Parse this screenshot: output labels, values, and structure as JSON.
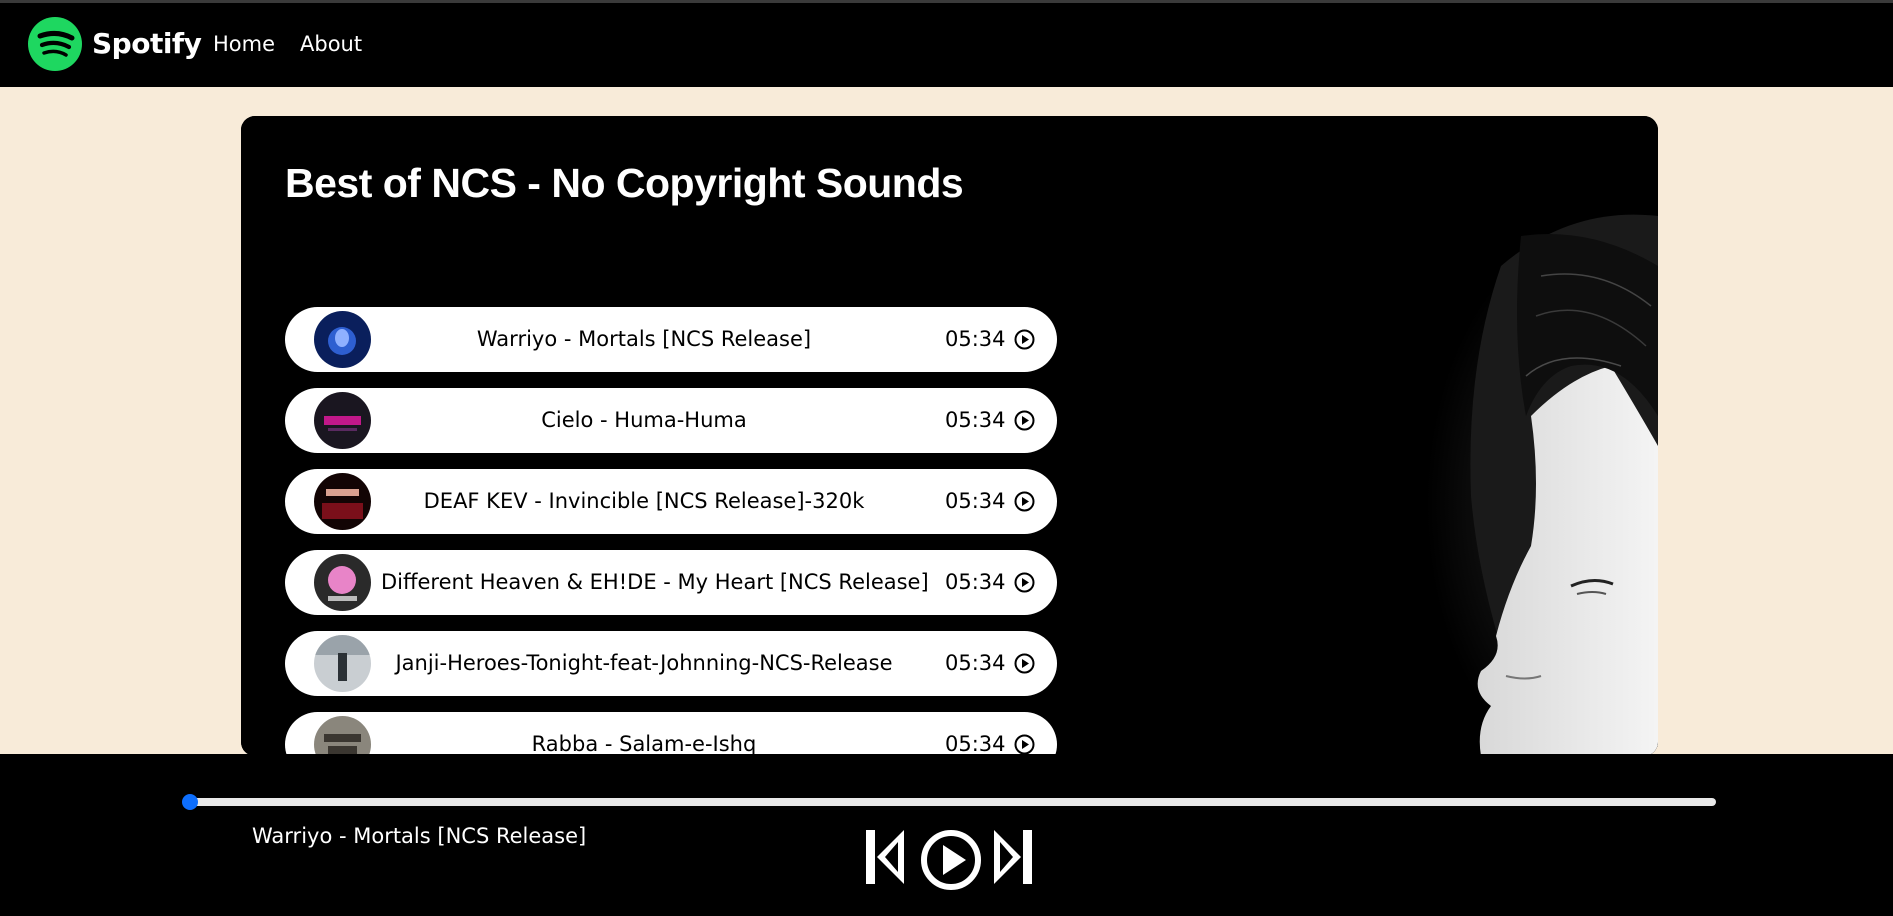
{
  "navbar": {
    "brand": "Spotify",
    "links": [
      "Home",
      "About"
    ]
  },
  "main": {
    "title": "Best of NCS - No Copyright Sounds",
    "songs": [
      {
        "name": "Warriyo - Mortals [NCS Release]",
        "duration": "05:34"
      },
      {
        "name": "Cielo - Huma-Huma",
        "duration": "05:34"
      },
      {
        "name": "DEAF KEV - Invincible [NCS Release]-320k",
        "duration": "05:34"
      },
      {
        "name": "Different Heaven & EH!DE - My Heart [NCS Release]",
        "duration": "05:34"
      },
      {
        "name": "Janji-Heroes-Tonight-feat-Johnning-NCS-Release",
        "duration": "05:34"
      },
      {
        "name": "Rabba - Salam-e-Ishq",
        "duration": "05:34"
      }
    ]
  },
  "player": {
    "now_playing": "Warriyo - Mortals [NCS Release]",
    "progress": 0
  },
  "colors": {
    "page_background": "#f8ebd9",
    "spotify_green": "#1ed760",
    "progress_accent": "#0d6efd"
  },
  "icons": {
    "logo": "spotify-logo-icon",
    "song_play": "play-circle-icon",
    "previous": "skip-back-icon",
    "play": "play-circle-icon",
    "next": "skip-forward-icon"
  }
}
